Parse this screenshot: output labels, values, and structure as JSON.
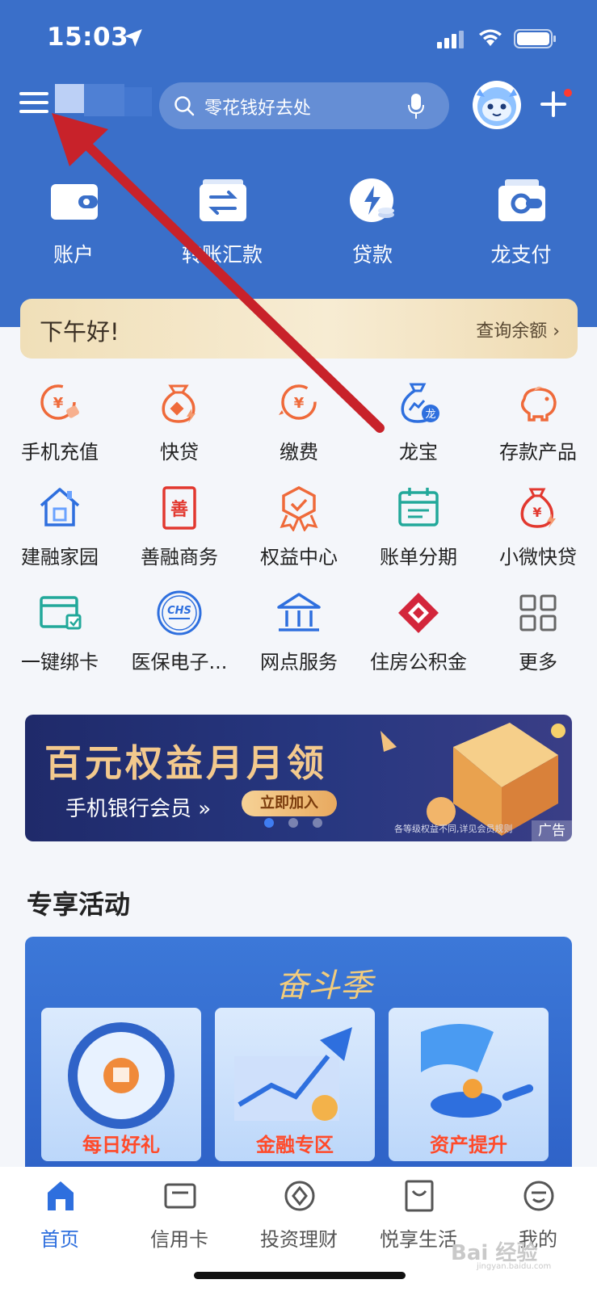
{
  "status": {
    "time": "15:03"
  },
  "search": {
    "placeholder": "零花钱好去处"
  },
  "quick_actions": [
    {
      "label": "账户",
      "icon": "wallet-icon"
    },
    {
      "label": "转账汇款",
      "icon": "transfer-icon"
    },
    {
      "label": "贷款",
      "icon": "loan-icon"
    },
    {
      "label": "龙支付",
      "icon": "long-pay-icon"
    }
  ],
  "greeting": {
    "text": "下午好!",
    "balance_link": "查询余额 ›"
  },
  "services": [
    {
      "label": "手机充值",
      "icon": "phone-recharge-icon"
    },
    {
      "label": "快贷",
      "icon": "quick-loan-icon"
    },
    {
      "label": "缴费",
      "icon": "payment-icon"
    },
    {
      "label": "龙宝",
      "icon": "longbao-icon"
    },
    {
      "label": "存款产品",
      "icon": "piggy-bank-icon"
    },
    {
      "label": "建融家园",
      "icon": "house-icon"
    },
    {
      "label": "善融商务",
      "icon": "shanrong-icon"
    },
    {
      "label": "权益中心",
      "icon": "badge-icon"
    },
    {
      "label": "账单分期",
      "icon": "calendar-icon"
    },
    {
      "label": "小微快贷",
      "icon": "micro-loan-icon"
    },
    {
      "label": "一键绑卡",
      "icon": "bind-card-icon"
    },
    {
      "label": "医保电子...",
      "icon": "chs-icon"
    },
    {
      "label": "网点服务",
      "icon": "branch-icon"
    },
    {
      "label": "住房公积金",
      "icon": "housing-fund-icon"
    },
    {
      "label": "更多",
      "icon": "grid-icon"
    }
  ],
  "chs_badge_text": "CHS",
  "longbao_badge_text": "龙",
  "shanrong_badge_text": "善",
  "banner": {
    "title": "百元权益月月领",
    "subtitle": "手机银行会员 »",
    "button": "立即加入",
    "note": "各等级权益不同,详见会员规则",
    "ad_tag": "广告"
  },
  "section": {
    "title": "专享活动"
  },
  "activity": {
    "logo": "奋斗季",
    "cards": [
      {
        "label": "每日好礼"
      },
      {
        "label": "金融专区"
      },
      {
        "label": "资产提升"
      }
    ]
  },
  "tabs": [
    {
      "label": "首页",
      "icon": "home-icon",
      "active": true
    },
    {
      "label": "信用卡",
      "icon": "credit-card-icon",
      "active": false
    },
    {
      "label": "投资理财",
      "icon": "invest-icon",
      "active": false
    },
    {
      "label": "悦享生活",
      "icon": "lifestyle-icon",
      "active": false
    },
    {
      "label": "我的",
      "icon": "profile-icon",
      "active": false
    }
  ],
  "watermark": {
    "text": "Bai 经验",
    "sub": "jingyan.baidu.com"
  },
  "colors": {
    "brand": "#3a6fc9",
    "accent_orange": "#ef6a3a",
    "tab_active": "#2e6fde",
    "annotation_arrow": "#c8222a"
  }
}
